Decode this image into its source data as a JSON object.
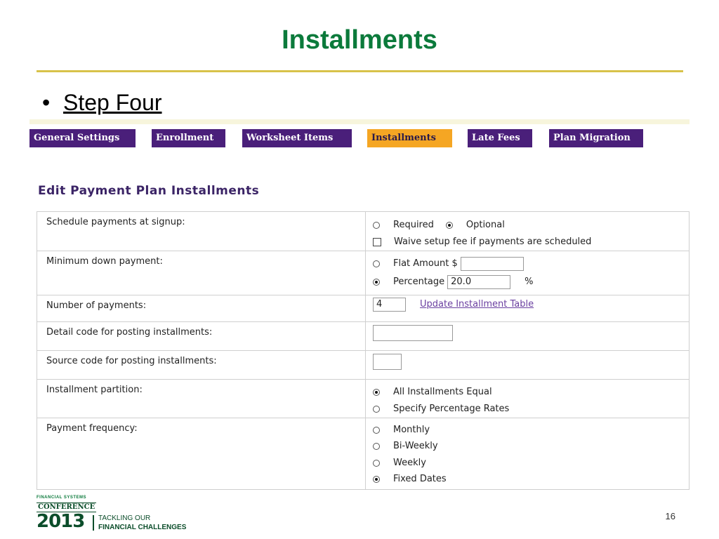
{
  "slide": {
    "title": "Installments",
    "bullet_symbol": "•",
    "bullet": "Step Four",
    "page_number": "16"
  },
  "tabs": [
    {
      "label": "General Settings",
      "active": false
    },
    {
      "label": "Enrollment",
      "active": false
    },
    {
      "label": "Worksheet Items",
      "active": false
    },
    {
      "label": "Installments",
      "active": true
    },
    {
      "label": "Late Fees",
      "active": false
    },
    {
      "label": "Plan Migration",
      "active": false
    }
  ],
  "panel": {
    "title": "Edit Payment Plan Installments",
    "rows": {
      "schedule": {
        "label": "Schedule payments at signup:",
        "required": "Required",
        "optional": "Optional",
        "selected": "Optional",
        "waive": "Waive setup fee if payments are scheduled",
        "waive_checked": false
      },
      "min_down": {
        "label": "Minimum down payment:",
        "flat": "Flat Amount $",
        "flat_value": "",
        "percentage": "Percentage",
        "percentage_value": "20.0",
        "percent_sign": "%",
        "selected": "Percentage"
      },
      "num_payments": {
        "label": "Number of payments:",
        "value": "4",
        "link": "Update Installment Table"
      },
      "detail_code": {
        "label": "Detail code for posting installments:",
        "value": ""
      },
      "source_code": {
        "label": "Source code for posting installments:",
        "value": ""
      },
      "partition": {
        "label": "Installment partition:",
        "equal": "All Installments Equal",
        "specify": "Specify Percentage Rates",
        "selected": "All Installments Equal"
      },
      "frequency": {
        "label": "Payment frequency:",
        "options": [
          "Monthly",
          "Bi-Weekly",
          "Weekly",
          "Fixed Dates"
        ],
        "selected": "Fixed Dates"
      }
    }
  },
  "logo": {
    "top": "FINANCIAL SYSTEMS",
    "conference": "CONFERENCE",
    "year": "2013",
    "tag1": "TACKLING OUR",
    "tag2": "FINANCIAL CHALLENGES"
  },
  "colors": {
    "title_green": "#0b7a3b",
    "rule_gold": "#d8c24a",
    "tab_purple": "#4a1f7a",
    "tab_active": "#f5a623",
    "panel_title": "#3b2466",
    "link": "#6a3fa0"
  }
}
